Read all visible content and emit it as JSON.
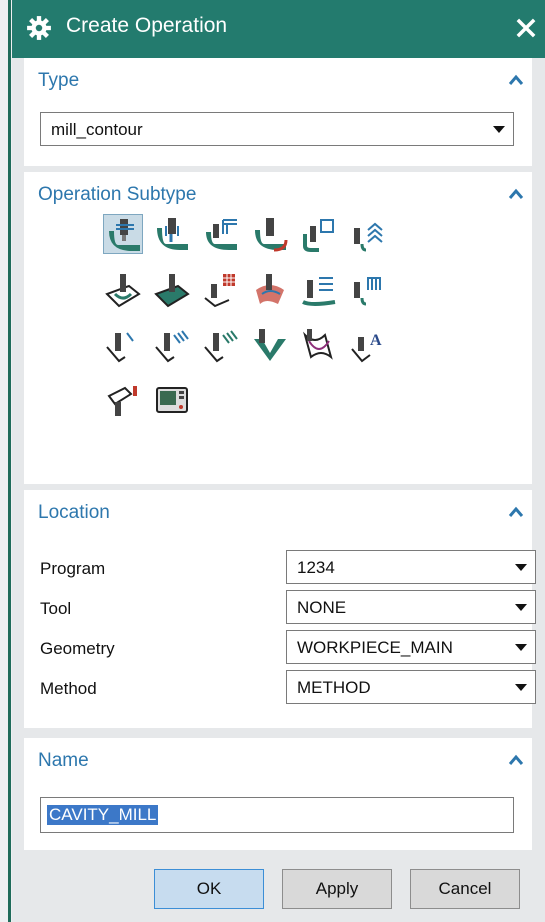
{
  "window": {
    "title": "Create Operation"
  },
  "type_section": {
    "header": "Type",
    "selected": "mill_contour"
  },
  "subtype_section": {
    "header": "Operation Subtype",
    "icons": [
      [
        "cavity-mill-icon",
        "plunge-mill-icon",
        "corner-rough-icon",
        "rest-mill-icon",
        "zlevel-profile-icon",
        "zlevel-corner-icon"
      ],
      [
        "fixed-contour-icon",
        "contour-area-icon",
        "contour-surface-area-icon",
        "streamline-icon",
        "contour-area-non-steep-icon",
        "contour-area-dir-steep-icon"
      ],
      [
        "flowcut-single-icon",
        "flowcut-multiple-icon",
        "flowcut-ref-tool-icon",
        "solid-profile-3d-icon",
        "profile-3d-icon",
        "contour-text-icon"
      ],
      [
        "mill-user-icon",
        "mill-control-icon"
      ]
    ]
  },
  "location_section": {
    "header": "Location",
    "fields": [
      {
        "label": "Program",
        "value": "1234"
      },
      {
        "label": "Tool",
        "value": "NONE"
      },
      {
        "label": "Geometry",
        "value": "WORKPIECE_MAIN"
      },
      {
        "label": "Method",
        "value": "METHOD"
      }
    ]
  },
  "name_section": {
    "header": "Name",
    "value": "CAVITY_MILL"
  },
  "buttons": {
    "ok": "OK",
    "apply": "Apply",
    "cancel": "Cancel"
  },
  "colors": {
    "titlebar": "#237b6e",
    "section_header": "#2d77ad",
    "selection": "#3c78c8"
  }
}
